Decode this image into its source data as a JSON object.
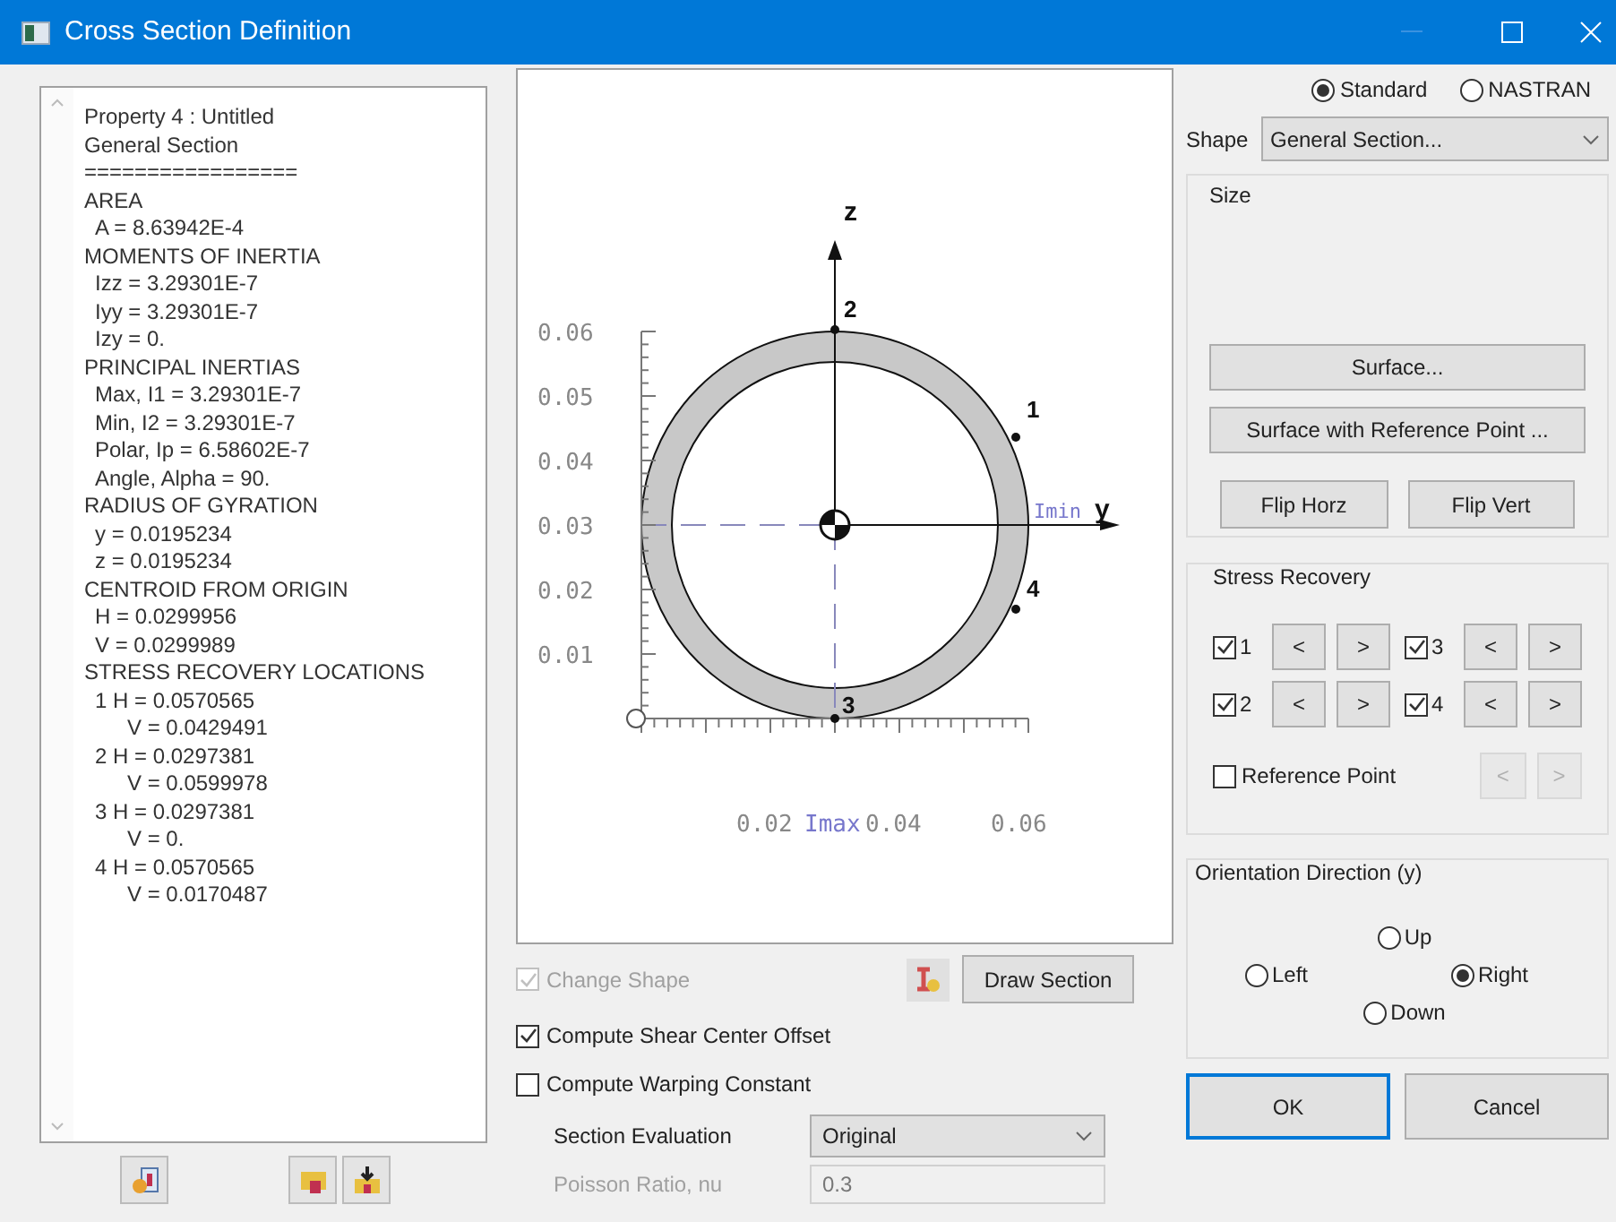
{
  "window": {
    "title": "Cross Section Definition"
  },
  "report": {
    "header": [
      "Property 4 : Untitled",
      "General Section",
      "================="
    ],
    "sections": [
      {
        "heading": "AREA",
        "items": [
          {
            "text": "A = 8.63942E-4"
          }
        ]
      },
      {
        "heading": "MOMENTS OF INERTIA",
        "items": [
          {
            "text": "Izz = 3.29301E-7"
          },
          {
            "text": "Iyy = 3.29301E-7"
          },
          {
            "text": "Izy = 0."
          }
        ]
      },
      {
        "heading": "PRINCIPAL INERTIAS",
        "items": [
          {
            "text": "Max, I1 = 3.29301E-7"
          },
          {
            "text": "Min, I2 = 3.29301E-7"
          },
          {
            "text": "Polar, Ip = 6.58602E-7"
          },
          {
            "text": "Angle, Alpha = 90."
          }
        ]
      },
      {
        "heading": "RADIUS OF GYRATION",
        "items": [
          {
            "text": "y = 0.0195234"
          },
          {
            "text": "z = 0.0195234"
          }
        ]
      },
      {
        "heading": "CENTROID FROM ORIGIN",
        "items": [
          {
            "text": "H = 0.0299956"
          },
          {
            "text": "V = 0.0299989"
          }
        ]
      },
      {
        "heading": "STRESS RECOVERY LOCATIONS",
        "items": [
          {
            "text": "1 H = 0.0570565",
            "children": [
              {
                "text": "V = 0.0429491"
              }
            ]
          },
          {
            "text": "2 H = 0.0297381",
            "children": [
              {
                "text": "V = 0.0599978"
              }
            ]
          },
          {
            "text": "3 H = 0.0297381",
            "children": [
              {
                "text": "V = 0."
              }
            ]
          },
          {
            "text": "4 H = 0.0570565",
            "children": [
              {
                "text": "V = 0.0170487"
              }
            ]
          }
        ]
      }
    ]
  },
  "plot": {
    "z_label": "z",
    "y_label": "y",
    "imin_label": "Imin",
    "imax_label": "Imax",
    "yticks": [
      "0.06",
      "0.05",
      "0.04",
      "0.03",
      "0.02",
      "0.01"
    ],
    "xticks": [
      "0.02",
      "0.04",
      "0.06"
    ],
    "points": [
      "1",
      "2",
      "3",
      "4"
    ]
  },
  "change_shape": {
    "label": "Change Shape",
    "checked": true,
    "disabled": true
  },
  "draw_section": {
    "label": "Draw Section"
  },
  "options": [
    {
      "label": "Compute Shear Center Offset",
      "checked": true
    },
    {
      "label": "Compute Warping Constant",
      "checked": false
    }
  ],
  "section_evaluation": {
    "label": "Section Evaluation",
    "value": "Original"
  },
  "poisson": {
    "label": "Poisson Ratio, nu",
    "value": "0.3",
    "disabled": true
  },
  "format": [
    {
      "label": "Standard",
      "selected": true
    },
    {
      "label": "NASTRAN",
      "selected": false
    }
  ],
  "shape": {
    "label": "Shape",
    "value": "General Section..."
  },
  "size": {
    "title": "Size",
    "surface": "Surface...",
    "surface_ref": "Surface with Reference Point ...",
    "flip_horz": "Flip Horz",
    "flip_vert": "Flip Vert"
  },
  "stress_recovery": {
    "title": "Stress Recovery",
    "rows": [
      [
        {
          "label": "1",
          "checked": true,
          "prev": "<",
          "next": ">"
        },
        {
          "label": "3",
          "checked": true,
          "prev": "<",
          "next": ">"
        }
      ],
      [
        {
          "label": "2",
          "checked": true,
          "prev": "<",
          "next": ">"
        },
        {
          "label": "4",
          "checked": true,
          "prev": "<",
          "next": ">"
        }
      ]
    ],
    "reference_point": {
      "label": "Reference Point",
      "checked": false,
      "prev": "<",
      "next": ">",
      "disabled": true
    }
  },
  "orientation": {
    "title": "Orientation Direction (y)",
    "options": [
      {
        "kind": "up",
        "label": "Up",
        "selected": false
      },
      {
        "kind": "left",
        "label": "Left",
        "selected": false
      },
      {
        "kind": "right",
        "label": "Right",
        "selected": true
      },
      {
        "kind": "down",
        "label": "Down",
        "selected": false
      }
    ]
  },
  "ok": {
    "label": "OK",
    "focused": true
  },
  "cancel": {
    "label": "Cancel"
  }
}
